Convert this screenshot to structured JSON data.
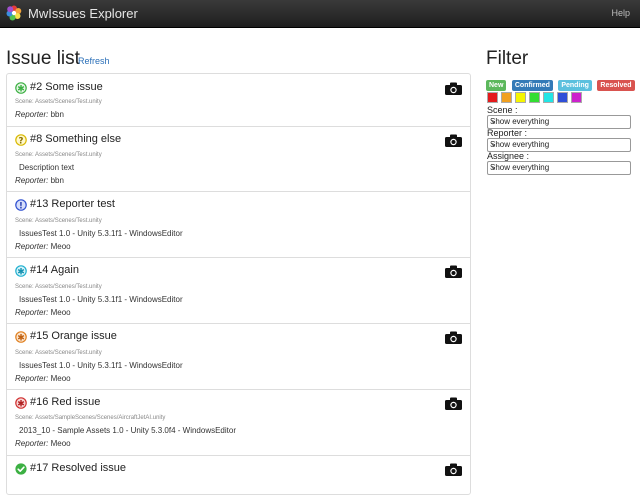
{
  "app": {
    "title": "MwIssues Explorer",
    "help": "Help"
  },
  "list": {
    "heading": "Issue list",
    "refresh": "Refresh",
    "reporter_label": "Reporter:",
    "issues": [
      {
        "title": "#2 Some issue",
        "scene": "Scene: Assets/Scenes/Test.unity",
        "description": "",
        "reporter": "bbn",
        "status_color": "#3cb043",
        "status_glyph": "✱",
        "icon": "new-status-icon",
        "camera": true
      },
      {
        "title": "#8 Something else",
        "scene": "Scene: Assets/Scenes/Test.unity",
        "description": "Description text",
        "reporter": "bbn",
        "status_color": "#f0d020",
        "status_glyph": "?",
        "icon": "question-status-icon",
        "camera": true
      },
      {
        "title": "#13 Reporter test",
        "scene": "Scene: Assets/Scenes/Test.unity",
        "description": "IssuesTest 1.0 - Unity 5.3.1f1 - WindowsEditor",
        "reporter": "Meoo",
        "status_color": "#3050d0",
        "status_glyph": "!",
        "icon": "exclamation-status-icon",
        "camera": false
      },
      {
        "title": "#14 Again",
        "scene": "Scene: Assets/Scenes/Test.unity",
        "description": "IssuesTest 1.0 - Unity 5.3.1f1 - WindowsEditor",
        "reporter": "Meoo",
        "status_color": "#20b0d0",
        "status_glyph": "✱",
        "icon": "cyan-status-icon",
        "camera": true
      },
      {
        "title": "#15 Orange issue",
        "scene": "Scene: Assets/Scenes/Test.unity",
        "description": "IssuesTest 1.0 - Unity 5.3.1f1 - WindowsEditor",
        "reporter": "Meoo",
        "status_color": "#e08020",
        "status_glyph": "✱",
        "icon": "orange-status-icon",
        "camera": true
      },
      {
        "title": "#16 Red issue",
        "scene": "Scene: Assets/SampleScenes/Scenes/AircraftJetAI.unity",
        "description": "2013_10 - Sample Assets 1.0 - Unity 5.3.0f4 - WindowsEditor",
        "reporter": "Meoo",
        "status_color": "#d03030",
        "status_glyph": "✱",
        "icon": "red-status-icon",
        "camera": true
      },
      {
        "title": "#17 Resolved issue",
        "scene": "",
        "description": "",
        "reporter": "",
        "status_color": "#3cb043",
        "status_glyph": "✔",
        "icon": "check-status-icon",
        "camera": true
      }
    ]
  },
  "filter": {
    "heading": "Filter",
    "tags": [
      {
        "label": "New",
        "color": "#5cb85c"
      },
      {
        "label": "Confirmed",
        "color": "#337ab7"
      },
      {
        "label": "Pending",
        "color": "#5bc0de"
      },
      {
        "label": "Resolved",
        "color": "#d9534f"
      }
    ],
    "colors": [
      "#e41a1c",
      "#f0a020",
      "#f5f500",
      "#33dd33",
      "#22e5e5",
      "#2e4fd8",
      "#cc22cc"
    ],
    "scene_label": "Scene :",
    "scene_value": "Show everything",
    "reporter_label": "Reporter :",
    "reporter_value": "Show everything",
    "assignee_label": "Assignee :",
    "assignee_value": "Show everything"
  }
}
